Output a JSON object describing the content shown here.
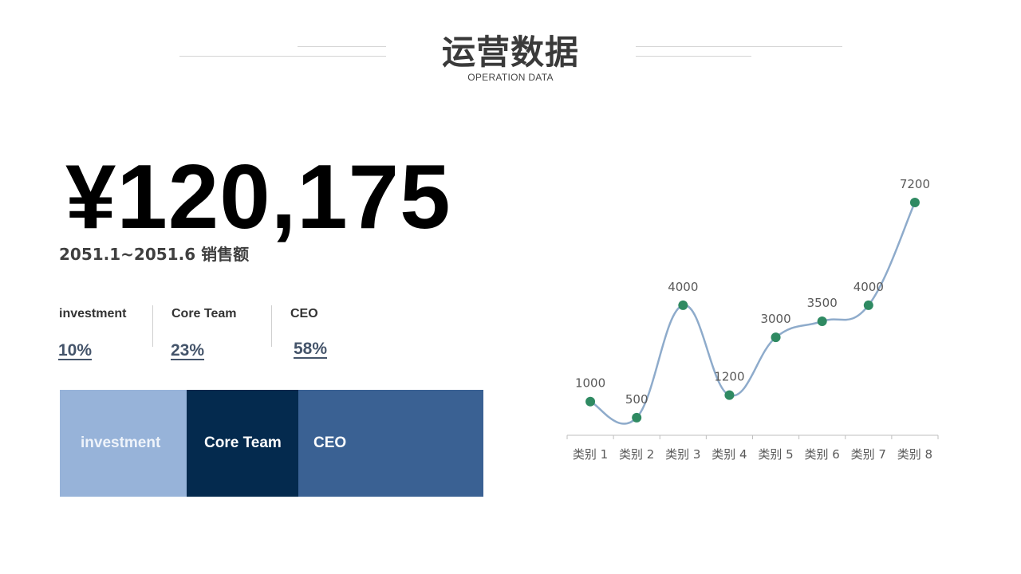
{
  "header": {
    "title": "运营数据",
    "subtitle": "OPERATION DATA"
  },
  "summary": {
    "amount": "¥120,175",
    "period": "2051.1~2051.6 销售额"
  },
  "stats": [
    {
      "label": "investment",
      "value": "10%"
    },
    {
      "label": "Core Team",
      "value": "23%"
    },
    {
      "label": "CEO",
      "value": "58%"
    }
  ],
  "segments": [
    {
      "label": "investment",
      "color": "#97b3d9"
    },
    {
      "label": "Core Team",
      "color": "#042a4e"
    },
    {
      "label": "CEO",
      "color": "#3a6193"
    }
  ],
  "colors": {
    "line": "#8eabcb",
    "marker": "#2f8a62",
    "axis": "#bfbfbf",
    "label": "#595959"
  },
  "chart_data": {
    "type": "line",
    "categories": [
      "类别 1",
      "类别 2",
      "类别 3",
      "类别 4",
      "类别 5",
      "类别 6",
      "类别 7",
      "类别 8"
    ],
    "series": [
      {
        "values": [
          1000,
          500,
          4000,
          1200,
          3000,
          3500,
          4000,
          7200
        ]
      }
    ],
    "data_labels": [
      "1000",
      "500",
      "4000",
      "1200",
      "3000",
      "3500",
      "4000",
      "7200"
    ],
    "smooth": true,
    "markers": true,
    "legend": "none",
    "grid": false,
    "title": "",
    "xlabel": "",
    "ylabel": ""
  }
}
